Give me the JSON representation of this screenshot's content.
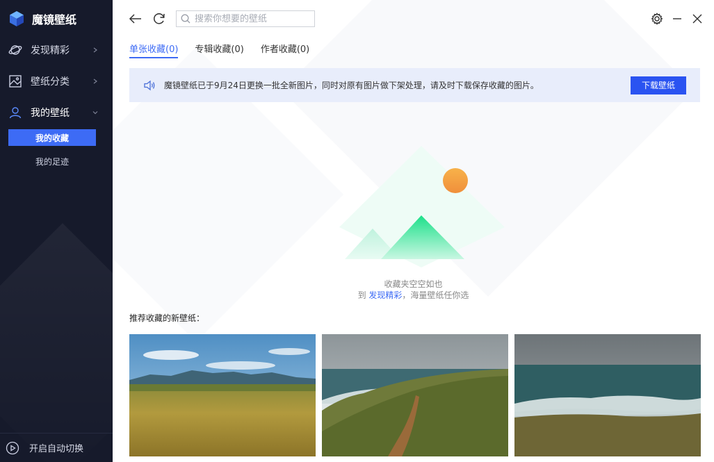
{
  "app": {
    "name": "魔镜壁纸"
  },
  "sidebar": {
    "items": [
      {
        "label": "发现精彩"
      },
      {
        "label": "壁纸分类"
      },
      {
        "label": "我的壁纸"
      }
    ],
    "subitems": [
      {
        "label": "我的收藏"
      },
      {
        "label": "我的足迹"
      }
    ],
    "auto_switch": "开启自动切换"
  },
  "search": {
    "placeholder": "搜索你想要的壁纸"
  },
  "tabs": [
    {
      "label": "单张收藏(0)"
    },
    {
      "label": "专辑收藏(0)"
    },
    {
      "label": "作者收藏(0)"
    }
  ],
  "notice": {
    "text": "魔镜壁纸已于9月24日更换一批全新图片，同时对原有图片做下架处理，请及时下载保存收藏的图片。",
    "button": "下载壁纸"
  },
  "empty": {
    "line1": "收藏夹空空如也",
    "prefix": "到 ",
    "link": "发现精彩",
    "suffix": "，海量壁纸任你选"
  },
  "recommend": {
    "title": "推荐收藏的新壁纸："
  },
  "colors": {
    "accent": "#3d6bf5",
    "button": "#2a53f1",
    "sidebar": "#161a2b",
    "notice_bg": "#e8edfb"
  }
}
